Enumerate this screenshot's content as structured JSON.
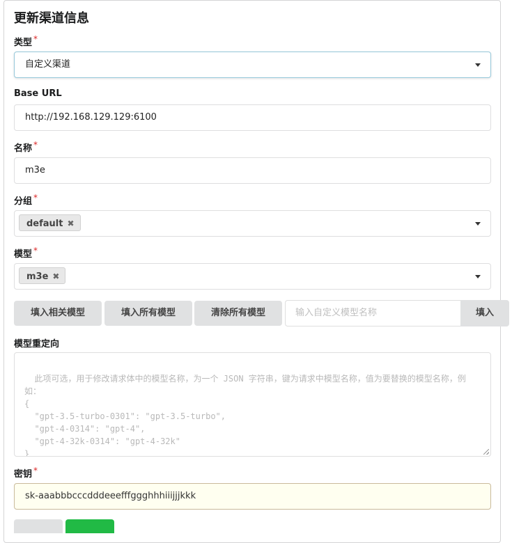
{
  "title": "更新渠道信息",
  "required_mark": "*",
  "type_field": {
    "label": "类型",
    "value": "自定义渠道"
  },
  "base_url_field": {
    "label": "Base URL",
    "value": "http://192.168.129.129:6100"
  },
  "name_field": {
    "label": "名称",
    "value": "m3e"
  },
  "group_field": {
    "label": "分组",
    "chips": [
      "default"
    ]
  },
  "model_field": {
    "label": "模型",
    "chips": [
      "m3e"
    ]
  },
  "model_buttons": {
    "fill_related": "填入相关模型",
    "fill_all": "填入所有模型",
    "clear_all": "清除所有模型",
    "custom_placeholder": "输入自定义模型名称",
    "fill": "填入"
  },
  "model_mapping": {
    "label": "模型重定向",
    "placeholder": "此项可选，用于修改请求体中的模型名称，为一个 JSON 字符串，键为请求中模型名称，值为要替换的模型名称，例如：\n{\n  \"gpt-3.5-turbo-0301\": \"gpt-3.5-turbo\",\n  \"gpt-4-0314\": \"gpt-4\",\n  \"gpt-4-32k-0314\": \"gpt-4-32k\"\n}"
  },
  "key_field": {
    "label": "密钥",
    "value": "sk-aaabbbcccdddeeefffggghhhiiijjjkkk"
  },
  "colors": {
    "required": "#db2828",
    "button_bg": "#e0e1e2",
    "submit_green": "#21ba45",
    "key_bg": "#fffff0"
  }
}
